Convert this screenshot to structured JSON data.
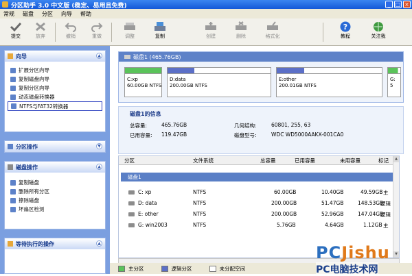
{
  "window": {
    "title": "分区助手 3.0 中文版 (稳定、易用且免费)",
    "min": "_",
    "max": "□",
    "close": "×"
  },
  "menu": [
    "常规",
    "磁盘",
    "分区",
    "向导",
    "帮助"
  ],
  "toolbar": [
    {
      "label": "提交",
      "icon": "check-icon",
      "enabled": true
    },
    {
      "label": "放弃",
      "icon": "discard-icon",
      "enabled": false
    },
    {
      "label": "撤销",
      "icon": "undo-icon",
      "enabled": false
    },
    {
      "label": "重做",
      "icon": "redo-icon",
      "enabled": false
    },
    {
      "label": "调整",
      "icon": "resize-disk-icon",
      "enabled": false
    },
    {
      "label": "复制",
      "icon": "copy-disk-icon",
      "enabled": true
    },
    {
      "label": "创建",
      "icon": "create-disk-icon",
      "enabled": false
    },
    {
      "label": "删除",
      "icon": "delete-disk-icon",
      "enabled": false
    },
    {
      "label": "格式化",
      "icon": "format-disk-icon",
      "enabled": false
    },
    {
      "label": "教程",
      "icon": "help-icon",
      "enabled": true
    },
    {
      "label": "关注我",
      "icon": "follow-icon",
      "enabled": true
    }
  ],
  "sidebar": {
    "wizard": {
      "title": "向导",
      "items": [
        "扩展分区向导",
        "复制磁盘向导",
        "复制分区向导",
        "动态磁盘转换器",
        "NTFS与FAT32转换器"
      ]
    },
    "partition_ops": {
      "title": "分区操作"
    },
    "disk_ops": {
      "title": "磁盘操作",
      "items": [
        "复制磁盘",
        "删除所有分区",
        "擦除磁盘",
        "坏扇区检测"
      ]
    },
    "pending": {
      "title": "等待执行的操作"
    }
  },
  "disk_map": {
    "header": "磁盘1 (465.76GB)",
    "partitions": [
      {
        "label": "C:xp",
        "size": "60.00GB NTFS",
        "color": "#5ac35a",
        "fill": 1.0
      },
      {
        "label": "D:data",
        "size": "200.00GB NTFS",
        "color": "#5b6fc7",
        "fill": 0.26
      },
      {
        "label": "E:other",
        "size": "200.01GB NTFS",
        "color": "#5b6fc7",
        "fill": 0.26
      },
      {
        "label": "G:",
        "size": "5",
        "color": "#5ac35a",
        "fill": 0.8
      }
    ]
  },
  "disk_info": {
    "title": "磁盘1的信息",
    "total_label": "总容量:",
    "total": "465.76GB",
    "used_label": "已用容量:",
    "used": "119.47GB",
    "geometry_label": "几何结构:",
    "geometry": "60801, 255, 63",
    "model_label": "磁盘型号:",
    "model": "WDC WD5000AAKX-001CA0"
  },
  "table": {
    "headers": [
      "分区",
      "文件系统",
      "总容量",
      "已用容量",
      "未用容量",
      "标记"
    ],
    "disk_row": "磁盘1",
    "rows": [
      {
        "partition": "C: xp",
        "fs": "NTFS",
        "total": "60.00GB",
        "used": "10.40GB",
        "free": "49.59GB",
        "flag": "主"
      },
      {
        "partition": "D: data",
        "fs": "NTFS",
        "total": "200.00GB",
        "used": "51.47GB",
        "free": "148.53GB",
        "flag": "逻辑"
      },
      {
        "partition": "E: other",
        "fs": "NTFS",
        "total": "200.00GB",
        "used": "52.96GB",
        "free": "147.04GB",
        "flag": "逻辑"
      },
      {
        "partition": "G: win2003",
        "fs": "NTFS",
        "total": "5.76GB",
        "used": "4.64GB",
        "free": "1.12GB",
        "flag": "主"
      }
    ]
  },
  "legend": [
    {
      "label": "主分区",
      "color": "#5ac35a"
    },
    {
      "label": "逻辑分区",
      "color": "#5b6fc7"
    },
    {
      "label": "未分配空间",
      "color": "#ffffff"
    }
  ],
  "watermark": {
    "line1a": "PC",
    "line1b": "Jishu",
    "line2": "PC电脑技术网"
  }
}
